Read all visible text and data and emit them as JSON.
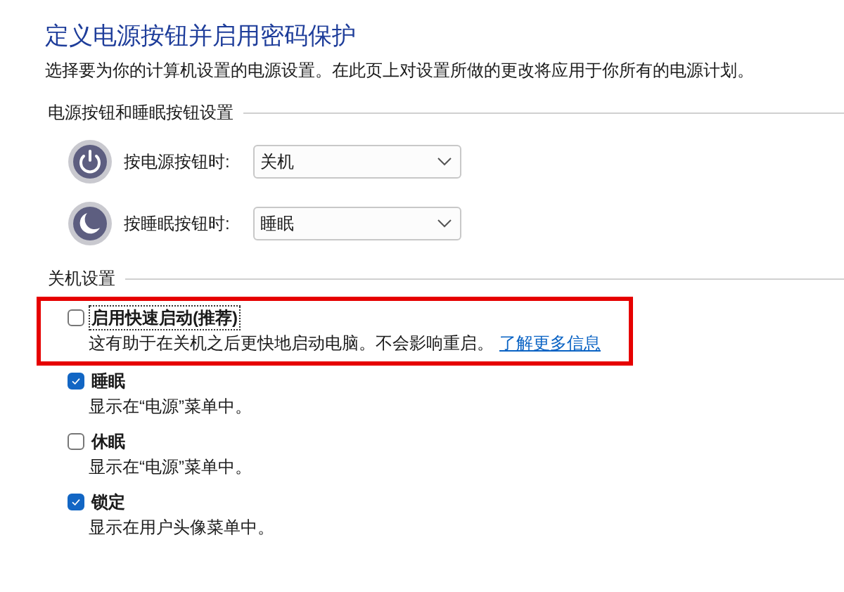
{
  "title": "定义电源按钮并启用密码保护",
  "description": "选择要为你的计算机设置的电源设置。在此页上对设置所做的更改将应用于你所有的电源计划。",
  "button_section": {
    "heading": "电源按钮和睡眠按钮设置",
    "rows": [
      {
        "kind": "power",
        "label": "按电源按钮时:",
        "value": "关机"
      },
      {
        "kind": "sleep",
        "label": "按睡眠按钮时:",
        "value": "睡眠"
      }
    ]
  },
  "shutdown_section": {
    "heading": "关机设置",
    "options": [
      {
        "label": "启用快速启动(推荐)",
        "checked": false,
        "highlighted": true,
        "focused": true,
        "description": "这有助于在关机之后更快地启动电脑。不会影响重启。",
        "link": "了解更多信息"
      },
      {
        "label": "睡眠",
        "checked": true,
        "highlighted": false,
        "focused": false,
        "description": "显示在“电源”菜单中。"
      },
      {
        "label": "休眠",
        "checked": false,
        "highlighted": false,
        "focused": false,
        "description": "显示在“电源”菜单中。"
      },
      {
        "label": "锁定",
        "checked": true,
        "highlighted": false,
        "focused": false,
        "description": "显示在用户头像菜单中。"
      }
    ]
  }
}
